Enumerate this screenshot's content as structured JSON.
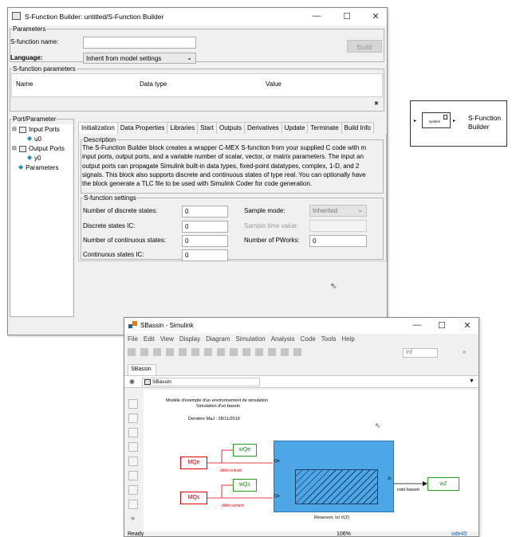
{
  "sfb": {
    "title": "S-Function Builder: untitled/S-Function Builder",
    "controls": {
      "minimize": "—",
      "maximize": "☐",
      "close": "✕"
    },
    "params_legend": "Parameters",
    "sfun_name_label": "S-function name:",
    "sfun_name_value": "",
    "build_label": "Build",
    "language_label": "Language:",
    "language_value": "Inherit from model settings",
    "sfun_params_legend": "S-function parameters",
    "param_cols": [
      "Name",
      "Data type",
      "Value"
    ],
    "delete_icon": "✖",
    "port_legend": "Port/Parameter",
    "tree": {
      "input_ports": "Input Ports",
      "u0": "u0",
      "output_ports": "Output Ports",
      "y0": "y0",
      "parameters": "Parameters"
    },
    "tabs": [
      "Initialization",
      "Data Properties",
      "Libraries",
      "Start",
      "Outputs",
      "Derivatives",
      "Update",
      "Terminate",
      "Build Info"
    ],
    "desc_legend": "Description",
    "desc_lines": [
      "The S-Function Builder block creates a wrapper C-MEX S-function from your supplied C code with m",
      "input ports, output ports, and a variable number of scalar, vector, or matrix parameters. The input an",
      "output ports can propagate Simulink built-in data types, fixed-point datatypes, complex, 1-D, and 2",
      "signals. This block also supports discrete and continuous states of type real. You can optionally have",
      "the block generate a TLC file to be used with Simulink Coder for code generation."
    ],
    "settings_legend": "S-function settings",
    "settings": {
      "n_discrete_label": "Number of discrete states:",
      "n_discrete_value": "0",
      "discrete_ic_label": "Discrete states IC:",
      "discrete_ic_value": "0",
      "n_continuous_label": "Number of continuous states:",
      "n_continuous_value": "0",
      "continuous_ic_label": "Continuous states IC:",
      "continuous_ic_value": "0",
      "sample_mode_label": "Sample mode:",
      "sample_mode_value": "Inherited",
      "sample_time_label": "Sample time value:",
      "sample_time_value": "",
      "pworks_label": "Number of PWorks:",
      "pworks_value": "0"
    }
  },
  "block": {
    "inner_label": "system",
    "name_line1": "S-Function",
    "name_line2": "Builder"
  },
  "sim": {
    "title": "SBassin - Simulink",
    "menu": [
      "File",
      "Edit",
      "View",
      "Display",
      "Diagram",
      "Simulation",
      "Analysis",
      "Code",
      "Tools",
      "Help"
    ],
    "sim_time": "Inf",
    "tab": "SBassin",
    "breadcrumb": "SBassin",
    "annot_line1": "Modèle d'exemple d'un environnement de simulation",
    "annot_line2": "Simulation d'un bassin",
    "annot_date": "Dernière MaJ : 28/11/2019",
    "mqe": "MQe",
    "mqs": "MQs",
    "wqe": "wQe",
    "wqs": "wQs",
    "debit_entrant": "débit entrant",
    "debit_sortant": "débit sortant",
    "port_qe": "Qe",
    "port_qs": "Qs",
    "port_zr": "Zr",
    "reservoir_label": "Réservoir, loi V(Z)",
    "cote_bassin": "cote bassin",
    "wz": "wZ",
    "status_ready": "Ready",
    "zoom": "106%",
    "solver": "ode45"
  }
}
